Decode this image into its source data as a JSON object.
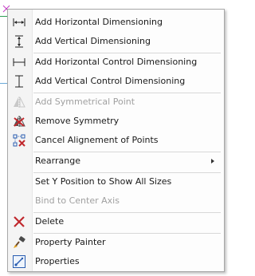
{
  "menu": {
    "items": [
      {
        "label": "Add Horizontal Dimensioning",
        "icon": "horizontal-dimension-icon",
        "enabled": true
      },
      {
        "label": "Add Vertical Dimensioning",
        "icon": "vertical-dimension-icon",
        "enabled": true
      },
      {
        "label": "Add Horizontal Control Dimensioning",
        "icon": "horizontal-control-dimension-icon",
        "enabled": true
      },
      {
        "label": "Add Vertical Control Dimensioning",
        "icon": "vertical-control-dimension-icon",
        "enabled": true
      },
      {
        "label": "Add Symmetrical Point",
        "icon": "symmetry-icon",
        "enabled": false
      },
      {
        "label": "Remove Symmetry",
        "icon": "remove-symmetry-icon",
        "enabled": true
      },
      {
        "label": "Cancel Alignement of Points",
        "icon": "cancel-alignment-icon",
        "enabled": true
      },
      {
        "label": "Rearrange",
        "icon": "",
        "enabled": true,
        "submenu": true
      },
      {
        "label": "Set Y Position to Show All Sizes",
        "icon": "",
        "enabled": true
      },
      {
        "label": "Bind to Center Axis",
        "icon": "",
        "enabled": false
      },
      {
        "label": "Delete",
        "icon": "delete-icon",
        "enabled": true
      },
      {
        "label": "Property Painter",
        "icon": "property-painter-icon",
        "enabled": true
      },
      {
        "label": "Properties",
        "icon": "properties-icon",
        "enabled": true
      }
    ]
  },
  "colors": {
    "menu_background": "#fdfdfd",
    "border": "#a8a8a8",
    "disabled_text": "#a0a0a0",
    "delete_red": "#c0282d",
    "icon_blue": "#2a5db0"
  }
}
